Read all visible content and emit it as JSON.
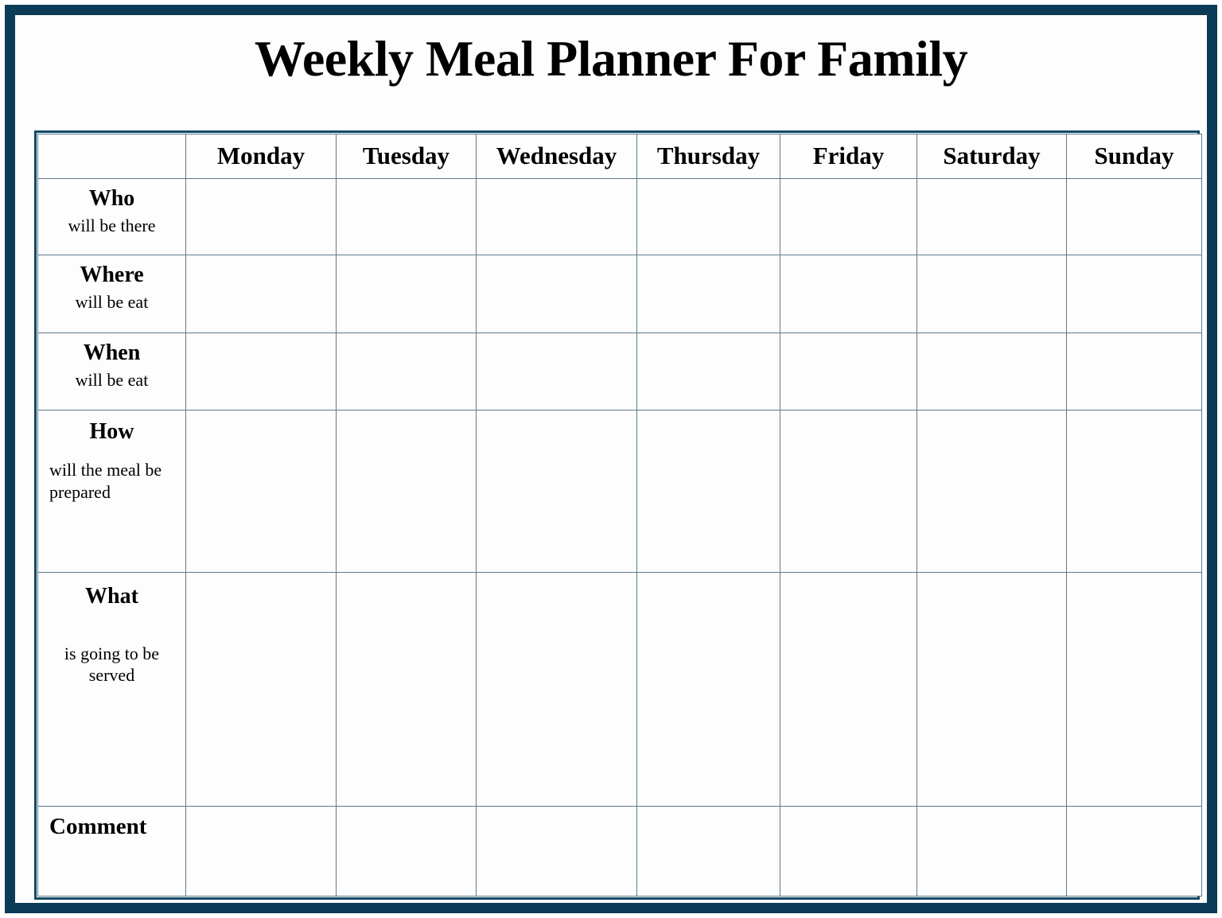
{
  "document": {
    "title": "Weekly Meal Planner For Family"
  },
  "theme": {
    "frame_color": "#0c3b57",
    "table_border_color": "#134864",
    "grid_line_color": "#5d7b8c",
    "page_background": "#fdfdfd",
    "text_color": "#000000"
  },
  "table": {
    "corner_header": "",
    "day_headers": [
      "Monday",
      "Tuesday",
      "Wednesday",
      "Thursday",
      "Friday",
      "Saturday",
      "Sunday"
    ],
    "rows": [
      {
        "term": "Who",
        "subtitle": "will be there",
        "cells": [
          "",
          "",
          "",
          "",
          "",
          "",
          ""
        ]
      },
      {
        "term": "Where",
        "subtitle": "will be eat",
        "cells": [
          "",
          "",
          "",
          "",
          "",
          "",
          ""
        ]
      },
      {
        "term": "When",
        "subtitle": "will be eat",
        "cells": [
          "",
          "",
          "",
          "",
          "",
          "",
          ""
        ]
      },
      {
        "term": "How",
        "subtitle": "will the meal be prepared",
        "cells": [
          "",
          "",
          "",
          "",
          "",
          "",
          ""
        ]
      },
      {
        "term": "What",
        "subtitle": "is going to be served",
        "cells": [
          "",
          "",
          "",
          "",
          "",
          "",
          ""
        ]
      },
      {
        "term": "Comment",
        "subtitle": "",
        "cells": [
          "",
          "",
          "",
          "",
          "",
          "",
          ""
        ]
      }
    ]
  }
}
